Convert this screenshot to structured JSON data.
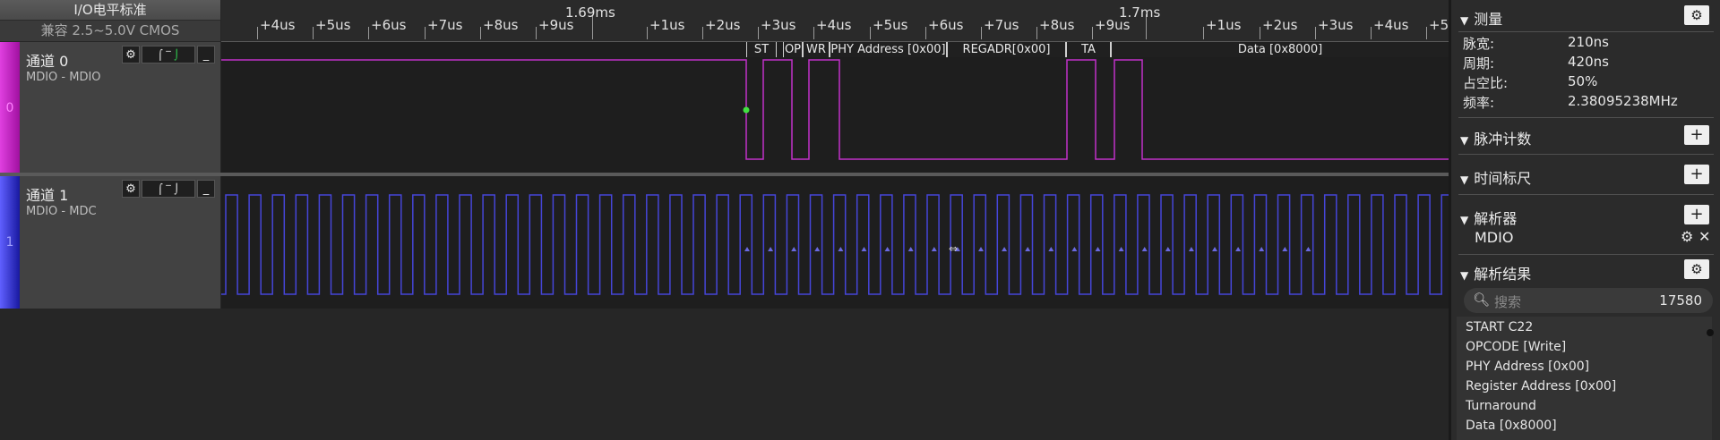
{
  "header": {
    "title": "I/O电平标准",
    "standard": "兼容 2.5~5.0V CMOS"
  },
  "ruler": {
    "ticks": [
      "+4us",
      "+5us",
      "+6us",
      "+7us",
      "+8us",
      "+9us",
      "+1us",
      "+2us",
      "+3us",
      "+4us",
      "+5us",
      "+6us",
      "+7us",
      "+8us",
      "+9us",
      "+1us",
      "+2us",
      "+3us",
      "+4us",
      "+5us"
    ],
    "majors": [
      "1.69ms",
      "1.7ms"
    ]
  },
  "channels": [
    {
      "num": "0",
      "name": "通道 0",
      "sub": "MDIO - MDIO",
      "color": "#c020c0"
    },
    {
      "num": "1",
      "name": "通道 1",
      "sub": "MDIO - MDC",
      "color": "#3030c8"
    }
  ],
  "decode": [
    "ST",
    "OP",
    "WR",
    "PHY Address [0x00]",
    "REGADR[0x00]",
    "TA",
    "Data [0x8000]"
  ],
  "panel": {
    "measure": {
      "title": "测量",
      "rows": [
        {
          "label": "脉宽:",
          "value": "210ns"
        },
        {
          "label": "周期:",
          "value": "420ns"
        },
        {
          "label": "占空比:",
          "value": "50%"
        },
        {
          "label": "频率:",
          "value": "2.38095238MHz"
        }
      ]
    },
    "pulse_count": "脉冲计数",
    "time_ruler": "时间标尺",
    "analyzer": {
      "title": "解析器",
      "item": "MDIO"
    },
    "results": {
      "title": "解析结果",
      "search_placeholder": "搜索",
      "count": "17580",
      "items": [
        "START C22",
        "OPCODE [Write]",
        "PHY Address [0x00]",
        "Register Address [0x00]",
        "Turnaround",
        "Data [0x8000]"
      ]
    }
  }
}
